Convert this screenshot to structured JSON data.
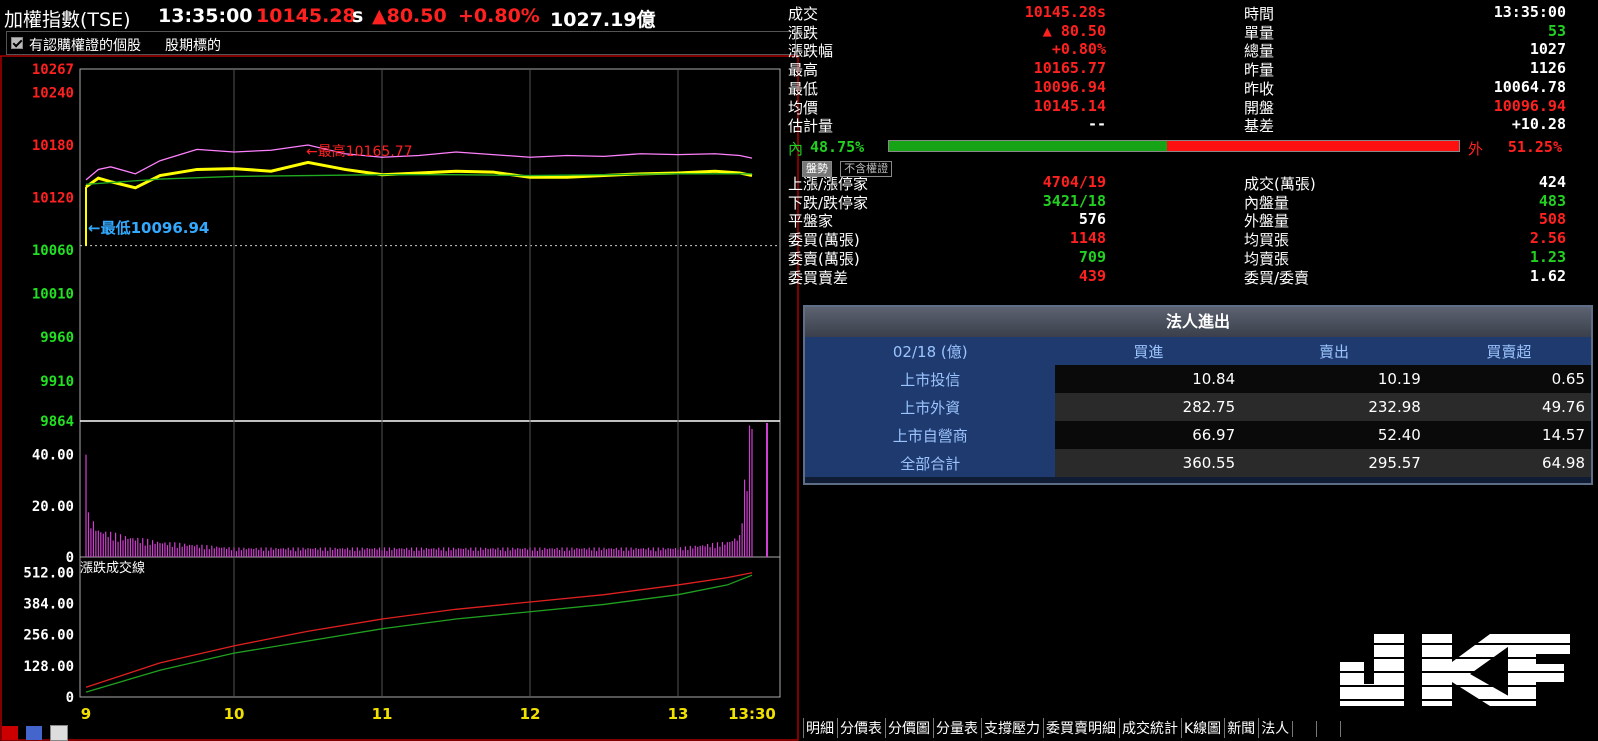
{
  "header": {
    "name": "加權指數(TSE)",
    "time": "13:35:00",
    "price": "10145.28",
    "price_flag": "s",
    "change": "▲80.50",
    "change_pct": "+0.80%",
    "amount": "1027.19億"
  },
  "options": {
    "warrant_label": "有認購權證的個股",
    "futures_label": "股期標的"
  },
  "chart": {
    "price_ticks": [
      "10267",
      "10240",
      "10180",
      "10120",
      "10060",
      "10010",
      "9960",
      "9910",
      "9864"
    ],
    "price_tick_colors": [
      "#ff2020",
      "#ff2020",
      "#ff2020",
      "#ff2020",
      "#22e022",
      "#22e022",
      "#22e022",
      "#22e022",
      "#22e022"
    ],
    "high_label": "←最高10165.77",
    "low_label": "←最低10096.94",
    "volume_ticks": [
      "40.00",
      "20.00",
      "0"
    ],
    "indicator_title": "漲跌成交線",
    "indicator_ticks": [
      "512.00",
      "384.00",
      "256.00",
      "128.00",
      "0"
    ],
    "time_ticks": [
      "9",
      "10",
      "11",
      "12",
      "13",
      "13:30"
    ]
  },
  "chart_data": {
    "type": "line",
    "x_axis": "time",
    "x_ticks": [
      "9",
      "10",
      "11",
      "12",
      "13",
      "13:30"
    ],
    "ylim": [
      9864,
      10267
    ],
    "series": [
      {
        "name": "",
        "x": [
          "9:00",
          "9:05",
          "9:10",
          "9:20",
          "9:30",
          "9:45",
          "10:00",
          "10:15",
          "10:30",
          "10:45",
          "11:00",
          "11:15",
          "11:30",
          "11:45",
          "12:00",
          "12:15",
          "12:30",
          "12:45",
          "13:00",
          "13:15",
          "13:25",
          "13:30"
        ],
        "values": [
          10132,
          10142,
          10138,
          10131,
          10145,
          10152,
          10153,
          10150,
          10160,
          10152,
          10146,
          10148,
          10150,
          10149,
          10143,
          10143,
          10145,
          10147,
          10148,
          10150,
          10148,
          10145
        ]
      },
      {
        "name": "",
        "x": [
          "9:00",
          "9:05",
          "9:10",
          "9:20",
          "9:30",
          "9:45",
          "10:00",
          "10:15",
          "10:30",
          "10:45",
          "11:00",
          "11:15",
          "11:30",
          "11:45",
          "12:00",
          "12:15",
          "12:30",
          "12:45",
          "13:00",
          "13:15",
          "13:25",
          "13:30"
        ],
        "values": [
          10140,
          10152,
          10155,
          10147,
          10162,
          10175,
          10172,
          10174,
          10180,
          10170,
          10166,
          10168,
          10172,
          10169,
          10166,
          10168,
          10167,
          10170,
          10169,
          10170,
          10168,
          10165
        ]
      },
      {
        "name": "",
        "x": [
          "9:00",
          "9:30",
          "10:00",
          "10:30",
          "11:00",
          "11:30",
          "12:00",
          "12:30",
          "13:00",
          "13:30"
        ],
        "values": [
          10135,
          10141,
          10144,
          10145,
          10146,
          10146,
          10145,
          10146,
          10147,
          10147
        ]
      }
    ],
    "volume": {
      "ylim": [
        0,
        50
      ],
      "x": [
        "9:00",
        "9:01",
        "9:05",
        "9:15",
        "9:30",
        "10:00",
        "11:00",
        "12:00",
        "13:00",
        "13:20",
        "13:25",
        "13:30"
      ],
      "values": [
        40,
        14,
        9,
        7,
        5,
        3,
        3,
        3,
        3,
        5,
        7,
        50
      ]
    },
    "breadth": {
      "ylim": [
        0,
        550
      ],
      "series": [
        {
          "name": "",
          "x": [
            "9:00",
            "9:30",
            "10:00",
            "10:30",
            "11:00",
            "11:30",
            "12:00",
            "12:30",
            "13:00",
            "13:20",
            "13:30"
          ],
          "values": [
            40,
            140,
            210,
            270,
            320,
            360,
            390,
            420,
            460,
            490,
            510
          ]
        },
        {
          "name": "",
          "x": [
            "9:00",
            "9:30",
            "10:00",
            "10:30",
            "11:00",
            "11:30",
            "12:00",
            "12:30",
            "13:00",
            "13:20",
            "13:30"
          ],
          "values": [
            20,
            110,
            180,
            230,
            280,
            320,
            350,
            380,
            420,
            460,
            500
          ]
        }
      ]
    }
  },
  "quote": {
    "left": [
      {
        "label": "成交",
        "value": "10145.28s",
        "color": "red"
      },
      {
        "label": "漲跌",
        "value": "▲ 80.50",
        "color": "red"
      },
      {
        "label": "漲跌幅",
        "value": "+0.80%",
        "color": "red"
      },
      {
        "label": "最高",
        "value": "10165.77",
        "color": "red"
      },
      {
        "label": "最低",
        "value": "10096.94",
        "color": "red"
      },
      {
        "label": "均價",
        "value": "10145.14",
        "color": "red"
      },
      {
        "label": "估計量",
        "value": "--",
        "color": "white"
      }
    ],
    "right": [
      {
        "label": "時間",
        "value": "13:35:00",
        "color": "white"
      },
      {
        "label": "單量",
        "value": "53",
        "color": "green"
      },
      {
        "label": "總量",
        "value": "1027",
        "color": "white"
      },
      {
        "label": "昨量",
        "value": "1126",
        "color": "white"
      },
      {
        "label": "昨收",
        "value": "10064.78",
        "color": "white"
      },
      {
        "label": "開盤",
        "value": "10096.94",
        "color": "red"
      },
      {
        "label": "基差",
        "value": "+10.28",
        "color": "white"
      }
    ],
    "inner_label": "內",
    "inner_pct": "48.75%",
    "inner_value": 48.75,
    "outer_label": "外",
    "outer_pct": "51.25%",
    "btn_a": "盤勢",
    "btn_b": "不含權證",
    "left2": [
      {
        "label": "上漲/漲停家",
        "value": "4704/19",
        "color": "red"
      },
      {
        "label": "下跌/跌停家",
        "value": "3421/18",
        "color": "green"
      },
      {
        "label": "平盤家",
        "value": "576",
        "color": "white"
      },
      {
        "label": "委買(萬張)",
        "value": "1148",
        "color": "red"
      },
      {
        "label": "委賣(萬張)",
        "value": "709",
        "color": "green"
      },
      {
        "label": "委買賣差",
        "value": "439",
        "color": "red"
      }
    ],
    "right2": [
      {
        "label": "成交(萬張)",
        "value": "424",
        "color": "white"
      },
      {
        "label": "內盤量",
        "value": "483",
        "color": "green"
      },
      {
        "label": "外盤量",
        "value": "508",
        "color": "red"
      },
      {
        "label": "均買張",
        "value": "2.56",
        "color": "red"
      },
      {
        "label": "均賣張",
        "value": "1.23",
        "color": "green"
      },
      {
        "label": "委買/委賣",
        "value": "1.62",
        "color": "white"
      }
    ]
  },
  "institutional": {
    "title": "法人進出",
    "headers": [
      "02/18 (億)",
      "買進",
      "賣出",
      "買賣超"
    ],
    "rows": [
      {
        "name": "上市投信",
        "buy": "10.84",
        "sell": "10.19",
        "net": "0.65"
      },
      {
        "name": "上市外資",
        "buy": "282.75",
        "sell": "232.98",
        "net": "49.76"
      },
      {
        "name": "上市自營商",
        "buy": "66.97",
        "sell": "52.40",
        "net": "14.57"
      },
      {
        "name": "全部合計",
        "buy": "360.55",
        "sell": "295.57",
        "net": "64.98"
      }
    ]
  },
  "tabs": [
    "明細",
    "分價表",
    "分價圖",
    "分量表",
    "支撐壓力",
    "委買賣明細",
    "成交統計",
    "K線圖",
    "新聞",
    "法人",
    "",
    "",
    ""
  ],
  "watermark": "JKF"
}
